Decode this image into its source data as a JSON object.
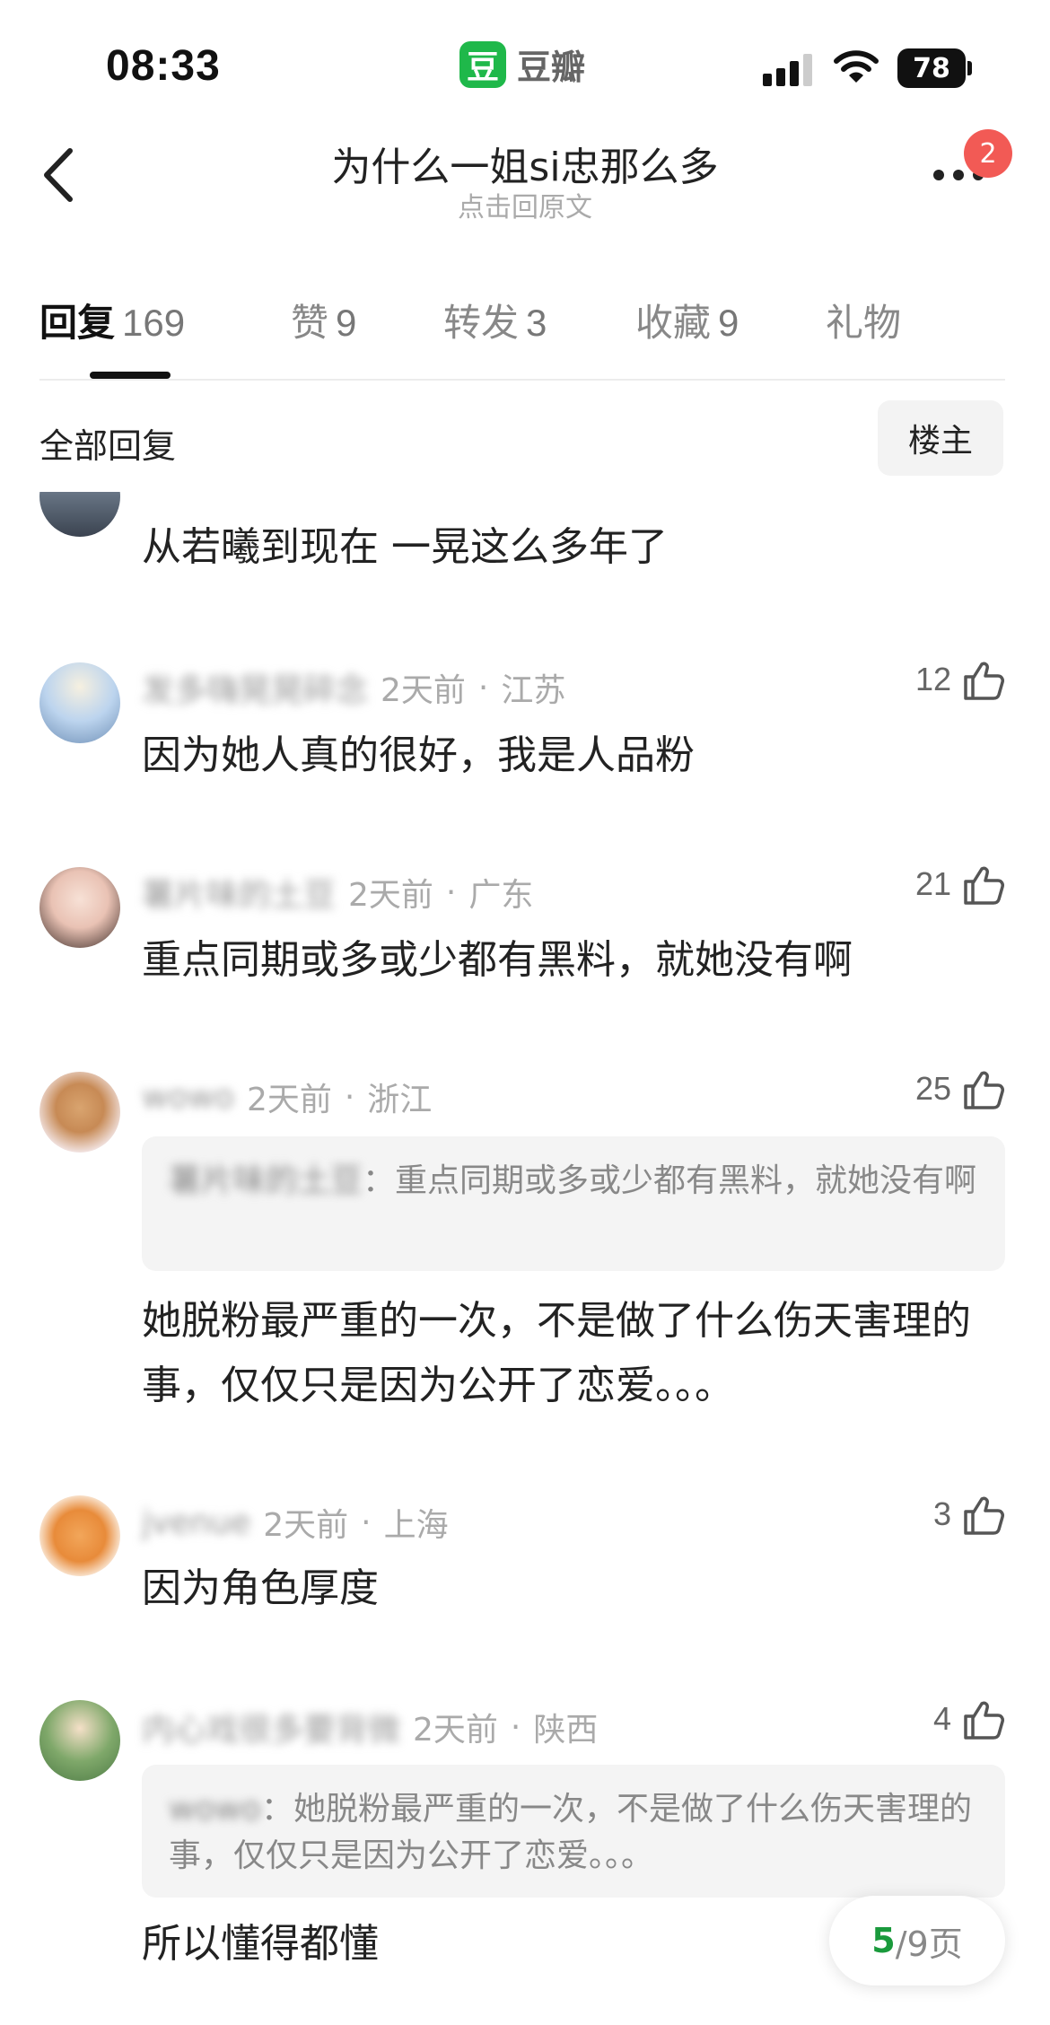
{
  "status_bar": {
    "time": "08:33",
    "app_logo_char": "豆",
    "app_name": "豆瓣",
    "battery": "78"
  },
  "header": {
    "title": "为什么一姐si忠那么多",
    "subtitle": "点击回原文",
    "notification_count": "2"
  },
  "tabs": [
    {
      "label": "回复",
      "count": "169",
      "active": true
    },
    {
      "label": "赞",
      "count": "9",
      "active": false
    },
    {
      "label": "转发",
      "count": "3",
      "active": false
    },
    {
      "label": "收藏",
      "count": "9",
      "active": false
    },
    {
      "label": "礼物",
      "count": "",
      "active": false
    }
  ],
  "section": {
    "label": "全部回复",
    "filter_label": "楼主"
  },
  "comments": [
    {
      "author": "",
      "time": "",
      "location": "",
      "likes": "",
      "quote_author": "",
      "quote_text": "",
      "text": "从若曦到现在 一晃这么多年了"
    },
    {
      "author": "发多嗨晃晃碎念",
      "time": "2天前",
      "location": "江苏",
      "likes": "12",
      "quote_author": "",
      "quote_text": "",
      "text": "因为她人真的很好，我是人品粉"
    },
    {
      "author": "薯片味的土豆",
      "time": "2天前",
      "location": "广东",
      "likes": "21",
      "quote_author": "",
      "quote_text": "",
      "text": "重点同期或多或少都有黑料，就她没有啊"
    },
    {
      "author": "wowo",
      "time": "2天前",
      "location": "浙江",
      "likes": "25",
      "quote_author": "薯片味的土豆",
      "quote_text": "重点同期或多或少都有黑料，就她没有啊",
      "text": "她脱粉最严重的一次，不是做了什么伤天害理的事，仅仅只是因为公开了恋爱。。。"
    },
    {
      "author": "jvenue",
      "time": "2天前",
      "location": "上海",
      "likes": "3",
      "quote_author": "",
      "quote_text": "",
      "text": "因为角色厚度"
    },
    {
      "author": "内心戏很多要背微",
      "time": "2天前",
      "location": "陕西",
      "likes": "4",
      "quote_author": "wowo",
      "quote_text": "她脱粉最严重的一次，不是做了什么伤天害理的事，仅仅只是因为公开了恋爱。。。",
      "text": "所以懂得都懂"
    }
  ],
  "pager": {
    "current": "5",
    "total": "/9页"
  },
  "colors": {
    "accent_green": "#1fb84a",
    "badge_red": "#f25a55",
    "page_green": "#1a9a3c"
  }
}
